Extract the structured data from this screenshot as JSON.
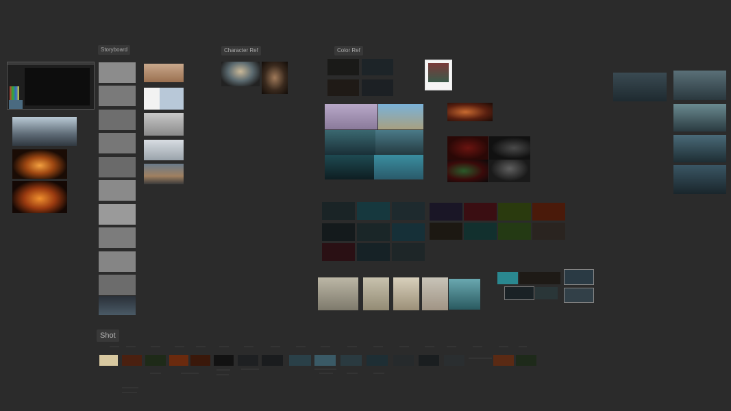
{
  "board": {
    "sections": {
      "storyboard": "Storyboard",
      "character_ref": "Character Ref",
      "color_ref": "Color Ref",
      "shot": "Shot"
    }
  },
  "colors": {
    "canvas": "#2b2b2b",
    "label_bg": "#383838",
    "label_text": "#a9a9a9"
  }
}
